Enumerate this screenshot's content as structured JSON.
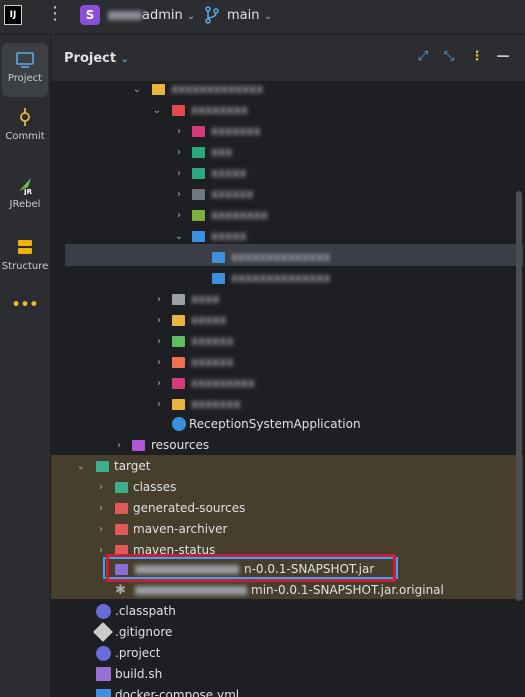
{
  "titlebar": {
    "logo": "IJ",
    "menu_icon": "⋮",
    "project_badge": "S",
    "project_name": "admin",
    "branch": "main",
    "accent": "#8a4fd8"
  },
  "tools": [
    {
      "label": "Project",
      "icon": "folder-icon"
    },
    {
      "label": "Commit",
      "icon": "commit-icon"
    },
    {
      "label": "JRebel",
      "icon": "jrebel-icon"
    },
    {
      "label": "Structure",
      "icon": "structure-icon"
    },
    {
      "label": "•••",
      "icon": "more-icon"
    }
  ],
  "panel": {
    "title": "Project"
  },
  "tree": {
    "blurred_1": "xxxxxxxxxxxxx",
    "blurred_2": "xxxxxxxx",
    "blurred_3": "xxxxxxx",
    "blurred_4": "xxx",
    "blurred_5": "xxxxx",
    "blurred_6": "xxxxxx",
    "blurred_7": "xxxxxxxx",
    "blurred_8": "xxxxx",
    "blurred_sel": "xxxxxxxxxxxxxx",
    "blurred_9": "xxxxxxxxxxxxxx",
    "blurred_10": "xxxx",
    "blurred_11": "xxxxx",
    "blurred_12": "xxxxxx",
    "blurred_13": "xxxxxx",
    "blurred_14": "xxxxxxxxx",
    "blurred_15": "xxxxxxx",
    "app_class": "ReceptionSystemApplication",
    "resources": "resources",
    "target": "target",
    "classes": "classes",
    "generated_sources": "generated-sources",
    "maven_archiver": "maven-archiver",
    "maven_status": "maven-status",
    "jar": "n-0.0.1-SNAPSHOT.jar",
    "jar_original": "min-0.0.1-SNAPSHOT.jar.original",
    "classpath": ".classpath",
    "gitignore": ".gitignore",
    "project": ".project",
    "build_sh": "build.sh",
    "docker_compose": "docker-compose.yml"
  }
}
